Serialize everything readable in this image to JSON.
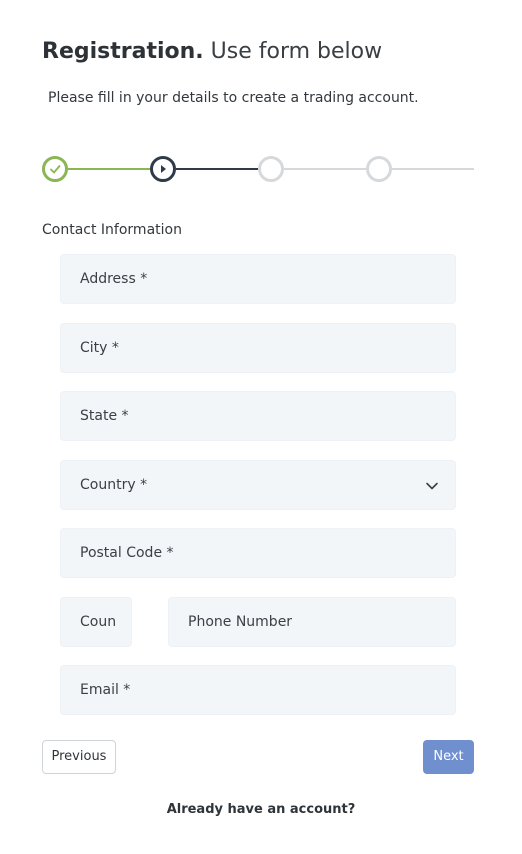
{
  "header": {
    "title_strong": "Registration.",
    "title_light": "Use form below",
    "subtitle": "Please fill in your details to create a trading account."
  },
  "stepper": {
    "steps": [
      {
        "state": "completed",
        "icon": "check-icon"
      },
      {
        "state": "current",
        "icon": "play-icon"
      },
      {
        "state": "upcoming",
        "icon": ""
      },
      {
        "state": "upcoming",
        "icon": ""
      }
    ],
    "colors": {
      "completed": "#8ab654",
      "current": "#2f3b48",
      "upcoming": "#d6d9dc"
    }
  },
  "form": {
    "section_label": "Contact Information",
    "fields": {
      "address": {
        "placeholder": "Address  *",
        "value": ""
      },
      "city": {
        "placeholder": "City  *",
        "value": ""
      },
      "state": {
        "placeholder": "State  *",
        "value": ""
      },
      "country": {
        "placeholder": "Country *",
        "value": "",
        "icon": "chevron-down-icon"
      },
      "postal_code": {
        "placeholder": "Postal Code  *",
        "value": ""
      },
      "country_code": {
        "placeholder": "Coun",
        "value": ""
      },
      "phone": {
        "placeholder": "Phone Number",
        "value": ""
      },
      "email": {
        "placeholder": "Email  *",
        "value": ""
      }
    }
  },
  "actions": {
    "previous_label": "Previous",
    "next_label": "Next",
    "next_color": "#6f8fcf"
  },
  "footer": {
    "login_text": "Already have an account?"
  }
}
